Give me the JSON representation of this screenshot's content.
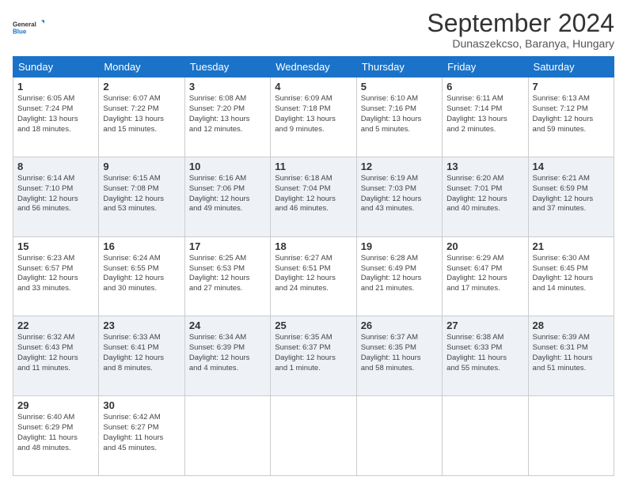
{
  "logo": {
    "line1": "General",
    "line2": "Blue"
  },
  "title": "September 2024",
  "subtitle": "Dunaszekcso, Baranya, Hungary",
  "columns": [
    "Sunday",
    "Monday",
    "Tuesday",
    "Wednesday",
    "Thursday",
    "Friday",
    "Saturday"
  ],
  "weeks": [
    [
      {
        "day": "1",
        "info": "Sunrise: 6:05 AM\nSunset: 7:24 PM\nDaylight: 13 hours\nand 18 minutes."
      },
      {
        "day": "2",
        "info": "Sunrise: 6:07 AM\nSunset: 7:22 PM\nDaylight: 13 hours\nand 15 minutes."
      },
      {
        "day": "3",
        "info": "Sunrise: 6:08 AM\nSunset: 7:20 PM\nDaylight: 13 hours\nand 12 minutes."
      },
      {
        "day": "4",
        "info": "Sunrise: 6:09 AM\nSunset: 7:18 PM\nDaylight: 13 hours\nand 9 minutes."
      },
      {
        "day": "5",
        "info": "Sunrise: 6:10 AM\nSunset: 7:16 PM\nDaylight: 13 hours\nand 5 minutes."
      },
      {
        "day": "6",
        "info": "Sunrise: 6:11 AM\nSunset: 7:14 PM\nDaylight: 13 hours\nand 2 minutes."
      },
      {
        "day": "7",
        "info": "Sunrise: 6:13 AM\nSunset: 7:12 PM\nDaylight: 12 hours\nand 59 minutes."
      }
    ],
    [
      {
        "day": "8",
        "info": "Sunrise: 6:14 AM\nSunset: 7:10 PM\nDaylight: 12 hours\nand 56 minutes."
      },
      {
        "day": "9",
        "info": "Sunrise: 6:15 AM\nSunset: 7:08 PM\nDaylight: 12 hours\nand 53 minutes."
      },
      {
        "day": "10",
        "info": "Sunrise: 6:16 AM\nSunset: 7:06 PM\nDaylight: 12 hours\nand 49 minutes."
      },
      {
        "day": "11",
        "info": "Sunrise: 6:18 AM\nSunset: 7:04 PM\nDaylight: 12 hours\nand 46 minutes."
      },
      {
        "day": "12",
        "info": "Sunrise: 6:19 AM\nSunset: 7:03 PM\nDaylight: 12 hours\nand 43 minutes."
      },
      {
        "day": "13",
        "info": "Sunrise: 6:20 AM\nSunset: 7:01 PM\nDaylight: 12 hours\nand 40 minutes."
      },
      {
        "day": "14",
        "info": "Sunrise: 6:21 AM\nSunset: 6:59 PM\nDaylight: 12 hours\nand 37 minutes."
      }
    ],
    [
      {
        "day": "15",
        "info": "Sunrise: 6:23 AM\nSunset: 6:57 PM\nDaylight: 12 hours\nand 33 minutes."
      },
      {
        "day": "16",
        "info": "Sunrise: 6:24 AM\nSunset: 6:55 PM\nDaylight: 12 hours\nand 30 minutes."
      },
      {
        "day": "17",
        "info": "Sunrise: 6:25 AM\nSunset: 6:53 PM\nDaylight: 12 hours\nand 27 minutes."
      },
      {
        "day": "18",
        "info": "Sunrise: 6:27 AM\nSunset: 6:51 PM\nDaylight: 12 hours\nand 24 minutes."
      },
      {
        "day": "19",
        "info": "Sunrise: 6:28 AM\nSunset: 6:49 PM\nDaylight: 12 hours\nand 21 minutes."
      },
      {
        "day": "20",
        "info": "Sunrise: 6:29 AM\nSunset: 6:47 PM\nDaylight: 12 hours\nand 17 minutes."
      },
      {
        "day": "21",
        "info": "Sunrise: 6:30 AM\nSunset: 6:45 PM\nDaylight: 12 hours\nand 14 minutes."
      }
    ],
    [
      {
        "day": "22",
        "info": "Sunrise: 6:32 AM\nSunset: 6:43 PM\nDaylight: 12 hours\nand 11 minutes."
      },
      {
        "day": "23",
        "info": "Sunrise: 6:33 AM\nSunset: 6:41 PM\nDaylight: 12 hours\nand 8 minutes."
      },
      {
        "day": "24",
        "info": "Sunrise: 6:34 AM\nSunset: 6:39 PM\nDaylight: 12 hours\nand 4 minutes."
      },
      {
        "day": "25",
        "info": "Sunrise: 6:35 AM\nSunset: 6:37 PM\nDaylight: 12 hours\nand 1 minute."
      },
      {
        "day": "26",
        "info": "Sunrise: 6:37 AM\nSunset: 6:35 PM\nDaylight: 11 hours\nand 58 minutes."
      },
      {
        "day": "27",
        "info": "Sunrise: 6:38 AM\nSunset: 6:33 PM\nDaylight: 11 hours\nand 55 minutes."
      },
      {
        "day": "28",
        "info": "Sunrise: 6:39 AM\nSunset: 6:31 PM\nDaylight: 11 hours\nand 51 minutes."
      }
    ],
    [
      {
        "day": "29",
        "info": "Sunrise: 6:40 AM\nSunset: 6:29 PM\nDaylight: 11 hours\nand 48 minutes."
      },
      {
        "day": "30",
        "info": "Sunrise: 6:42 AM\nSunset: 6:27 PM\nDaylight: 11 hours\nand 45 minutes."
      },
      {
        "day": "",
        "info": ""
      },
      {
        "day": "",
        "info": ""
      },
      {
        "day": "",
        "info": ""
      },
      {
        "day": "",
        "info": ""
      },
      {
        "day": "",
        "info": ""
      }
    ]
  ]
}
